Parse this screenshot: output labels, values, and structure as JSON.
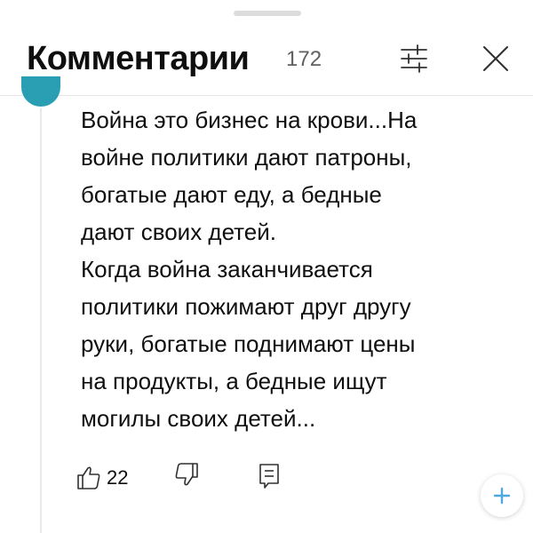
{
  "header": {
    "title": "Комментарии",
    "count": "172"
  },
  "comment": {
    "text": "Война это бизнес на крови...На\nвойне политики дают патроны,\nбогатые дают еду, а бедные\nдают своих детей.\nКогда война заканчивается\nполитики пожимают друг другу\nруки, богатые поднимают цены\nна продукты, а бедные ищут\nмогилы своих детей...",
    "like_count": "22"
  },
  "colors": {
    "avatar": "#2a9fb3",
    "fab_plus": "#4fa8e0"
  },
  "icons": {
    "filter": "filter-icon",
    "close": "close-icon",
    "like": "thumbs-up-icon",
    "dislike": "thumbs-down-icon",
    "reply": "reply-icon",
    "add": "plus-icon"
  }
}
